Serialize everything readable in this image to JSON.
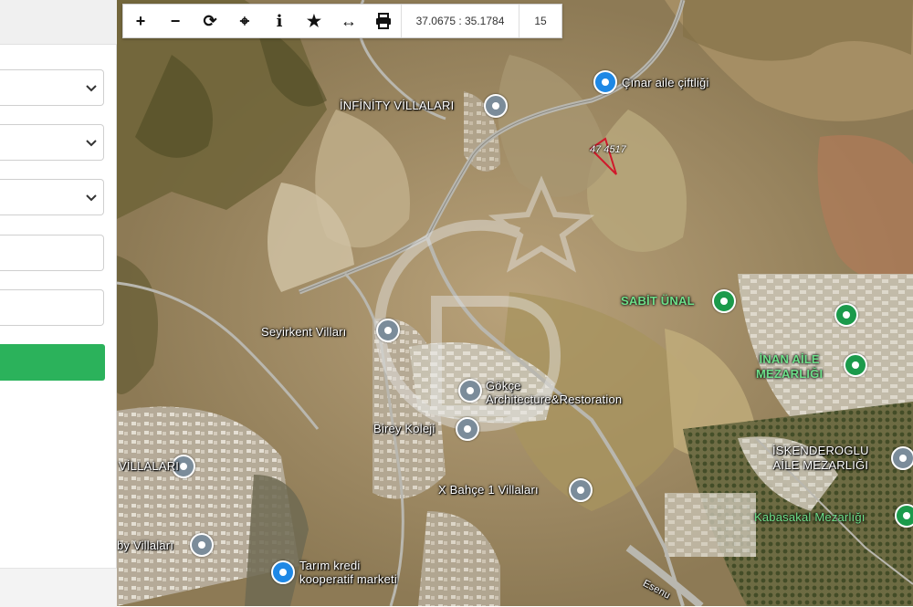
{
  "toolbar": {
    "buttons": [
      {
        "name": "zoom-in",
        "glyph": "+"
      },
      {
        "name": "zoom-out",
        "glyph": "−"
      },
      {
        "name": "refresh",
        "glyph": "⟳"
      },
      {
        "name": "locate",
        "glyph": "⌖"
      },
      {
        "name": "info",
        "glyph": "i"
      },
      {
        "name": "favorite",
        "glyph": "★"
      },
      {
        "name": "measure",
        "glyph": "↔"
      },
      {
        "name": "print",
        "glyph": "print"
      }
    ],
    "coordinates": "37.0675 : 35.1784",
    "zoom_level": "15"
  },
  "map": {
    "parcel_label": "47 4517",
    "places": [
      {
        "id": "cinar",
        "label": "Çınar aile çiftliği",
        "icon": "lock-icon",
        "style": "blue"
      },
      {
        "id": "infinity",
        "label": "İNFİNİTY VİLLALARI",
        "icon": "location-icon",
        "style": "grey"
      },
      {
        "id": "seyirkent",
        "label": "Seyirkent Vilları",
        "icon": "location-icon",
        "style": "grey"
      },
      {
        "id": "gokece",
        "label": "Gökçe\nArchitecture&Restoration",
        "icon": "location-icon",
        "style": "grey"
      },
      {
        "id": "birey",
        "label": "Birey Koleji",
        "icon": "school-icon",
        "style": "grey"
      },
      {
        "id": "villalari-left",
        "label": "VİLLALARI",
        "icon": "location-icon",
        "style": "grey"
      },
      {
        "id": "bahce",
        "label": "X Bahçe 1 Villaları",
        "icon": "location-icon",
        "style": "grey"
      },
      {
        "id": "by-villalari",
        "label": "by Villaları",
        "icon": "location-icon",
        "style": "grey"
      },
      {
        "id": "tarim",
        "label": "Tarım kredi\nkooperatif marketi",
        "icon": "lock-icon",
        "style": "blue"
      },
      {
        "id": "sabit",
        "label": "SABİT ÜNAL",
        "icon": "tree-icon",
        "style": "green"
      },
      {
        "id": "inan",
        "label": "İNAN AİLE\nMEZARLIĞI",
        "icon": "tree-icon",
        "style": "green"
      },
      {
        "id": "iskenderoglu",
        "label": "İSKENDEROGLU\nAİLE MEZARLIĞI",
        "icon": "museum-icon",
        "style": "grey"
      },
      {
        "id": "kabasakal",
        "label": "Kabasakal Mezarlığı",
        "icon": "tree-icon",
        "style": "green"
      },
      {
        "id": "esenyurt",
        "label": "Esenu",
        "icon": "road-icon",
        "style": "road"
      }
    ]
  },
  "colors": {
    "accent_green": "#2bb25b",
    "pin_blue": "#1e88e5",
    "pin_green": "#1b9a4b",
    "pin_grey": "#7b8c9a",
    "parcel_outline": "#d0192b"
  }
}
